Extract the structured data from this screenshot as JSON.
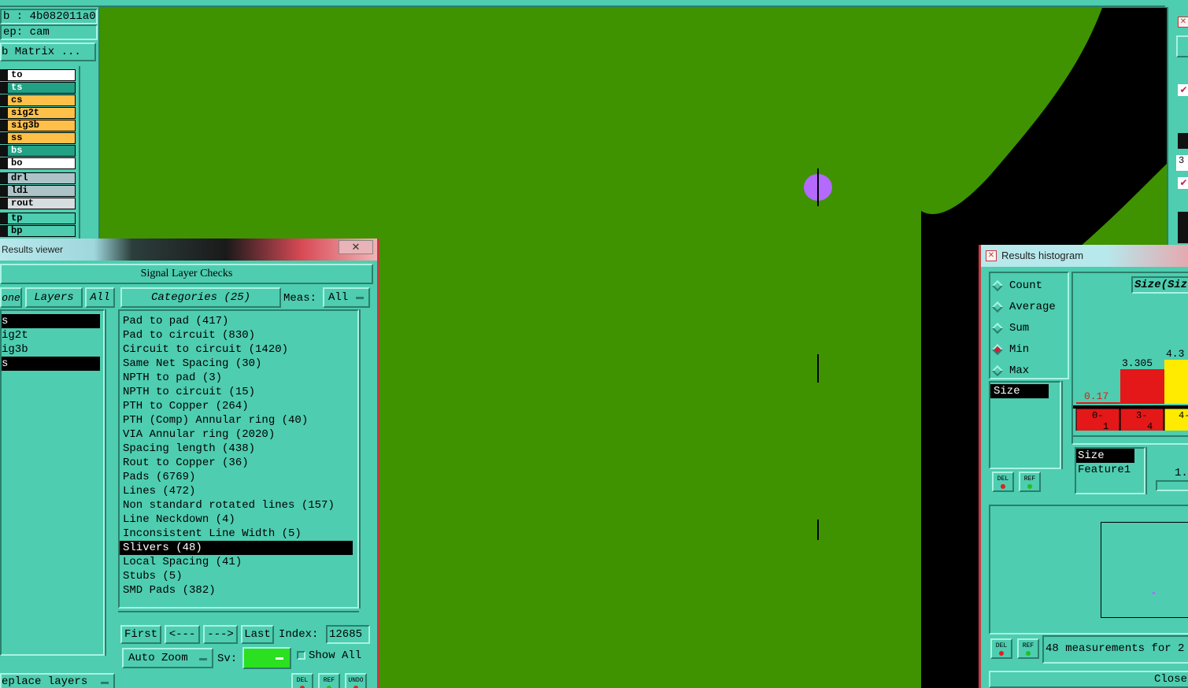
{
  "layout_top_left": {
    "job_line": "b : 4b082011a0",
    "step_line": "ep: cam",
    "matrix_button": "b Matrix ..."
  },
  "layers": [
    {
      "name": "to",
      "color": "#ffffff"
    },
    {
      "name": "ts",
      "color": "#22a184"
    },
    {
      "name": "cs",
      "color": "#ffc04a"
    },
    {
      "name": "sig2t",
      "color": "#ffc04a"
    },
    {
      "name": "sig3b",
      "color": "#ffc04a"
    },
    {
      "name": "ss",
      "color": "#ffc04a"
    },
    {
      "name": "bs",
      "color": "#22a184"
    },
    {
      "name": "bo",
      "color": "#ffffff"
    },
    {
      "name": "drl",
      "color": "#aec3c8"
    },
    {
      "name": "ldi",
      "color": "#aec3c8"
    },
    {
      "name": "rout",
      "color": "#d7dee0"
    },
    {
      "name": "tp",
      "color": "#4ecdb0"
    },
    {
      "name": "bp",
      "color": "#4ecdb0"
    }
  ],
  "results_viewer": {
    "title": "Results viewer",
    "header": "Signal Layer Checks",
    "tab_none": "one",
    "tab_layers": "Layers",
    "tab_all": "All",
    "categories_label": "Categories (25)",
    "meas_label": "Meas:",
    "meas_value": "All",
    "left_list": [
      "s",
      "ig2t",
      "ig3b",
      "s"
    ],
    "categories": [
      "Pad to pad (417)",
      "Pad to circuit (830)",
      "Circuit to circuit (1420)",
      "Same Net Spacing (30)",
      "NPTH to pad (3)",
      "NPTH to circuit (15)",
      "PTH to Copper (264)",
      "PTH (Comp) Annular ring (40)",
      "VIA Annular ring (2020)",
      "Spacing length (438)",
      "Rout to Copper (36)",
      "Pads (6769)",
      "Lines (472)",
      "Non standard rotated lines (157)",
      "Line Neckdown (4)",
      "Inconsistent Line Width (5)",
      "Slivers (48)",
      "Local Spacing (41)",
      "Stubs (5)",
      "SMD Pads (382)"
    ],
    "selected_category": 16,
    "nav_first": "First",
    "nav_prev": "<---",
    "nav_next": "--->",
    "nav_last": "Last",
    "index_label": "Index:",
    "index_value": "12685",
    "auto_zoom": "Auto Zoom",
    "sv_label": "Sv:",
    "show_all": "Show All",
    "replace_layers": "eplace layers",
    "btn_del": "DEL",
    "btn_ref": "REF",
    "btn_undo": "UNDO"
  },
  "histogram": {
    "title": "Results histogram",
    "options": [
      "Count",
      "Average",
      "Sum",
      "Min",
      "Max"
    ],
    "selected_option": "Min",
    "chart_title": "Size(Siz",
    "list_left": "Size",
    "list_bottom": [
      "Size",
      "Feature1"
    ],
    "slider_value": "1.",
    "bar_values": [
      "0.17",
      "3.305",
      "4.3"
    ],
    "bins": [
      "0-\n1",
      "3-\n4",
      "4-\n5"
    ],
    "status": "48 measurements for 2",
    "close": "Close",
    "btn_del": "DEL",
    "btn_ref": "REF"
  },
  "colors": {
    "board_green": "#3f9300",
    "copper_black": "#000000",
    "panel_teal": "#4ecdb0",
    "marker_purple": "#b469ff"
  }
}
